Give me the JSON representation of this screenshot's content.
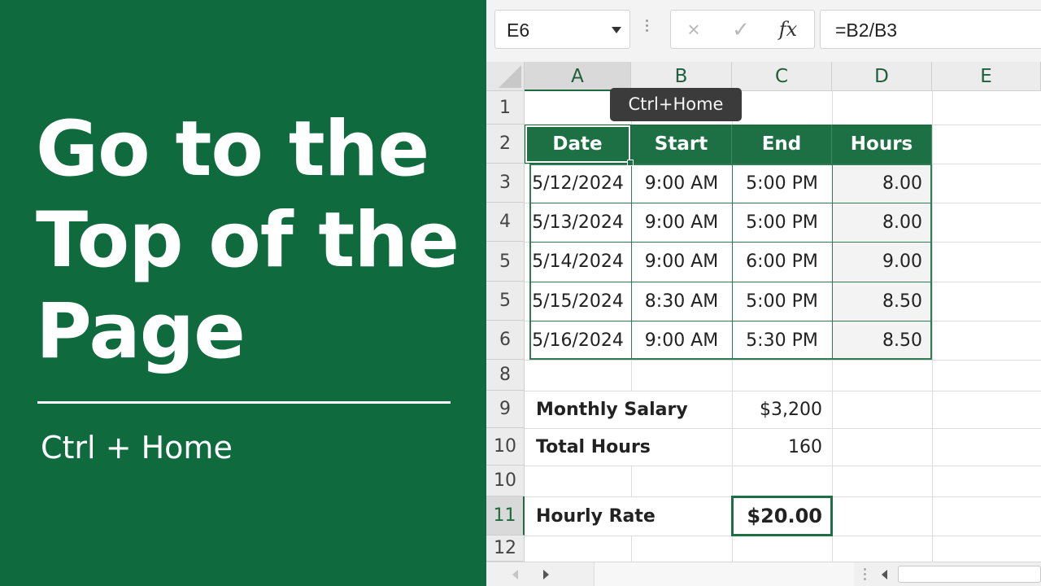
{
  "promo": {
    "headline_lines": [
      "Go to the",
      "Top of the",
      "Page"
    ],
    "shortcut": "Ctrl + Home"
  },
  "formula_bar": {
    "name_box": "E6",
    "cancel_icon": "×",
    "enter_icon": "✓",
    "function_icon": "fx",
    "formula": "=B2/B3"
  },
  "tooltip": "Ctrl+Home",
  "columns": [
    "A",
    "B",
    "C",
    "D",
    "E"
  ],
  "rows": [
    "1",
    "2",
    "3",
    "4",
    "5",
    "5",
    "6",
    "8",
    "9",
    "10",
    "10",
    "11",
    "12"
  ],
  "table": {
    "headers": [
      "Date",
      "Start",
      "End",
      "Hours"
    ],
    "rows": [
      [
        "5/12/2024",
        "9:00 AM",
        "5:00 PM",
        "8.00"
      ],
      [
        "5/13/2024",
        "9:00 AM",
        "5:00 PM",
        "8.00"
      ],
      [
        "5/14/2024",
        "9:00 AM",
        "6:00 PM",
        "9.00"
      ],
      [
        "5/15/2024",
        "8:30 AM",
        "5:00 PM",
        "8.50"
      ],
      [
        "5/16/2024",
        "9:00 AM",
        "5:30 PM",
        "8.50"
      ]
    ]
  },
  "summary": {
    "salary_label": "Monthly Salary",
    "salary_value": "$3,200",
    "hours_label": "Total Hours",
    "hours_value": "160",
    "rate_label": "Hourly Rate",
    "rate_value": "$20.00"
  },
  "colors": {
    "brand_green": "#0f6b3e",
    "header_green": "#1d7044"
  }
}
